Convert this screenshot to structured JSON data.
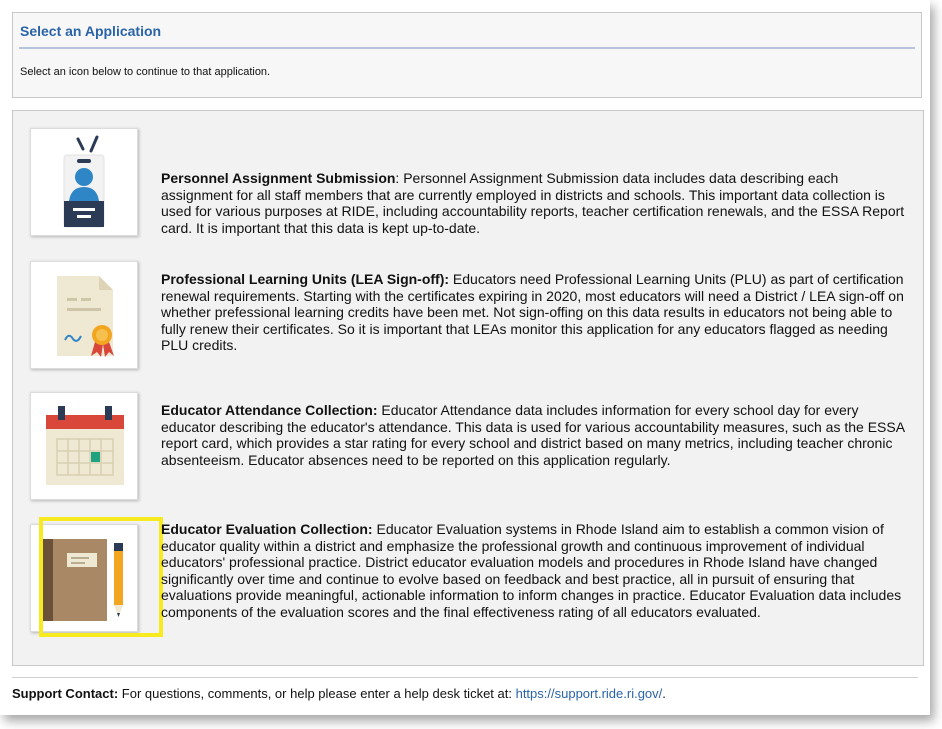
{
  "header": {
    "title": "Select an Application",
    "subtitle": "Select an icon below to continue to that application."
  },
  "apps": [
    {
      "title": "Personnel Assignment Submission",
      "title_sep": ":",
      "description": " Personnel Assignment Submission data includes data describing each assignment for all staff members that are currently employed in districts and schools. This important data collection is used for various purposes at RIDE, including accountability reports, teacher certification renewals, and the ESSA Report card. It is important that this data is kept up-to-date.",
      "icon": "id-badge-icon"
    },
    {
      "title": "Professional Learning Units (LEA Sign-off):",
      "title_sep": "",
      "description": " Educators need Professional Learning Units (PLU) as part of certification renewal requirements. Starting with the certificates expiring in 2020, most educators will need a District / LEA sign-off on whether prefessional learning credits have been met. Not sign-offing on this data results in educators not being able to fully renew their certificates. So it is important that LEAs monitor this application for any educators flagged as needing PLU credits.",
      "icon": "certificate-icon"
    },
    {
      "title": "Educator Attendance Collection:",
      "title_sep": "",
      "description": " Educator Attendance data includes information for every school day for every educator describing the educator's attendance. This data is used for various accountability measures, such as the ESSA report card, which provides a star rating for every school and district based on many metrics, including teacher chronic absenteeism. Educator absences need to be reported on this application regularly.",
      "icon": "calendar-icon"
    },
    {
      "title": "Educator Evaluation Collection:",
      "title_sep": "",
      "description": " Educator Evaluation systems in Rhode Island aim to establish a common vision of educator quality within a district and emphasize the professional growth and continuous improvement of individual educators' professional practice. District educator evaluation models and procedures in Rhode Island have changed significantly over time and continue to evolve based on feedback and best practice, all in pursuit of ensuring that evaluations provide meaningful, actionable information to inform changes in practice. Educator Evaluation data includes components of the evaluation scores and the final effectiveness rating of all educators evaluated.",
      "icon": "notebook-pencil-icon"
    }
  ],
  "footer": {
    "label": "Support Contact:",
    "text": " For questions, comments, or help please enter a help desk ticket at: ",
    "link": "https://support.ride.ri.gov/",
    "end": "."
  },
  "colors": {
    "accent": "#2a63a8",
    "highlight": "#f7ea1f"
  }
}
